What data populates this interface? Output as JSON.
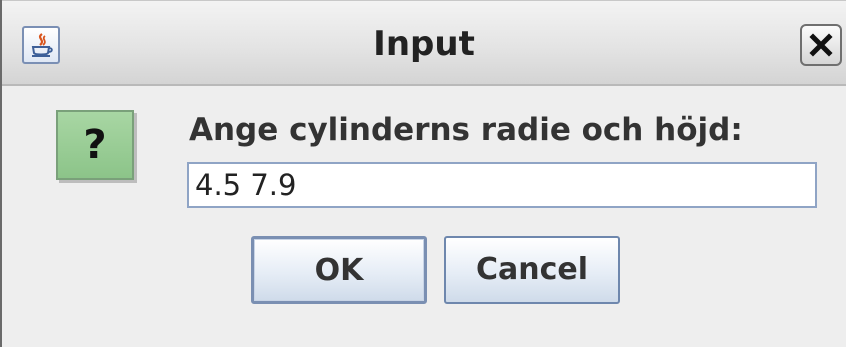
{
  "window": {
    "title": "Input",
    "app_icon": "java-icon",
    "close_icon": "close-icon"
  },
  "message": {
    "icon": "question-icon",
    "icon_glyph": "?",
    "prompt": "Ange cylinderns radie och höjd:"
  },
  "input": {
    "value": "4.5 7.9"
  },
  "buttons": {
    "ok_label": "OK",
    "cancel_label": "Cancel"
  },
  "colors": {
    "question_icon_bg": "#9fd19b",
    "button_border": "#6e87ad",
    "input_border": "#8fa4c5"
  }
}
